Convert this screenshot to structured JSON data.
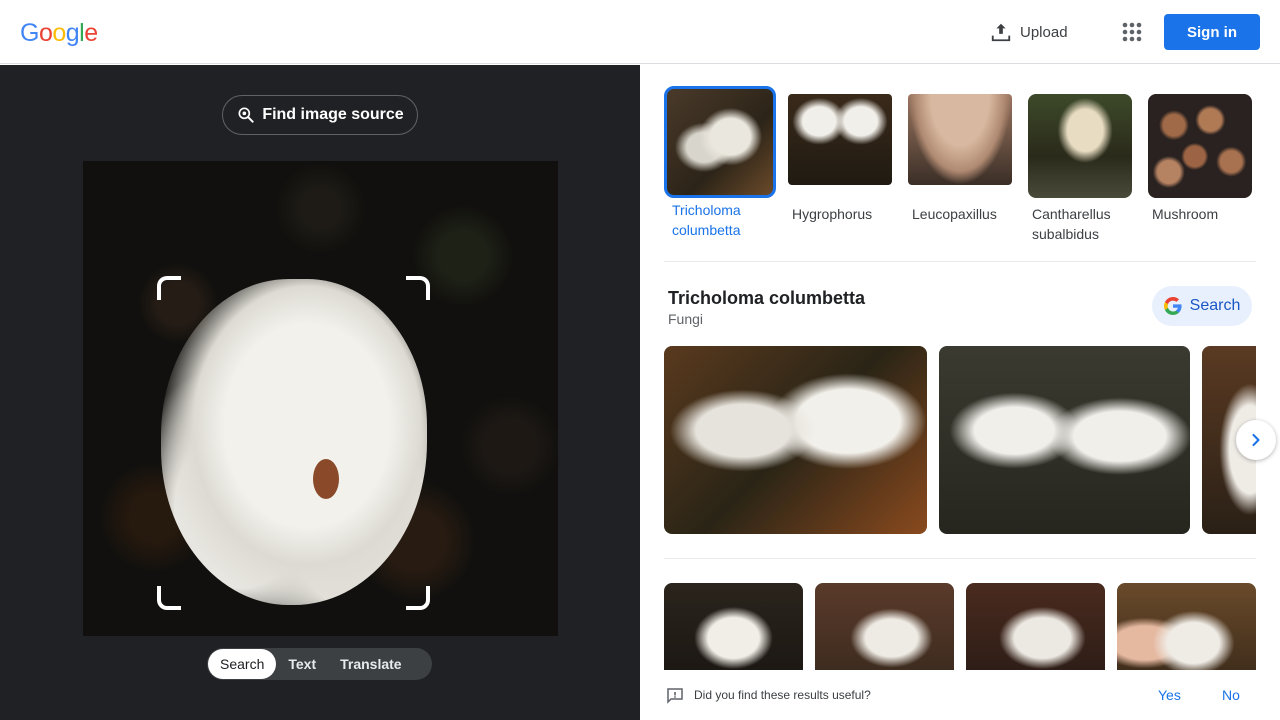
{
  "header": {
    "logo_text": "Google",
    "upload_label": "Upload",
    "signin_label": "Sign in"
  },
  "left_panel": {
    "find_source_label": "Find image source",
    "mode_tabs": [
      "Search",
      "Text",
      "Translate"
    ],
    "active_mode": "Search"
  },
  "chips": [
    {
      "label": "Tricholoma columbetta",
      "selected": true
    },
    {
      "label": "Hygrophorus",
      "selected": false
    },
    {
      "label": "Leucopaxillus",
      "selected": false
    },
    {
      "label": "Cantharellus subalbidus",
      "selected": false
    },
    {
      "label": "Mushroom",
      "selected": false
    }
  ],
  "result": {
    "title": "Tricholoma columbetta",
    "subtitle": "Fungi",
    "search_label": "Search"
  },
  "feedback": {
    "question": "Did you find these results useful?",
    "yes": "Yes",
    "no": "No"
  },
  "colors": {
    "accent": "#1a73e8",
    "left_bg": "#202124",
    "search_btn_bg": "#e8f0fe"
  }
}
